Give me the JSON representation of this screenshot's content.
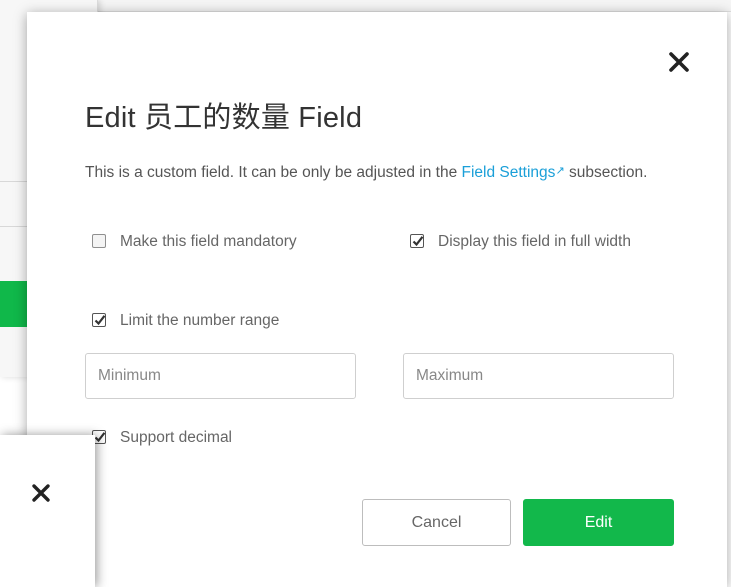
{
  "modal": {
    "title": "Edit 员工的数量 Field",
    "description_prefix": "This is a custom field. It can be only be adjusted in the ",
    "description_link": "Field Settings",
    "description_suffix": " subsection.",
    "options": {
      "mandatory": {
        "label": "Make this field mandatory",
        "checked": false
      },
      "full_width": {
        "label": "Display this field in full width",
        "checked": true
      },
      "limit_range": {
        "label": "Limit the number range",
        "checked": true
      },
      "support_decimal": {
        "label": "Support decimal",
        "checked": true
      }
    },
    "minimum": {
      "placeholder": "Minimum",
      "value": ""
    },
    "maximum": {
      "placeholder": "Maximum",
      "value": ""
    },
    "cancel_label": "Cancel",
    "edit_label": "Edit"
  },
  "icons": {
    "close": "close-icon",
    "external_link": "external-link-icon",
    "checkmark": "checkmark-icon"
  },
  "colors": {
    "accent_green": "#12b84b",
    "link_blue": "#1a9fd8",
    "title_text": "#333333",
    "body_text": "#666666"
  }
}
